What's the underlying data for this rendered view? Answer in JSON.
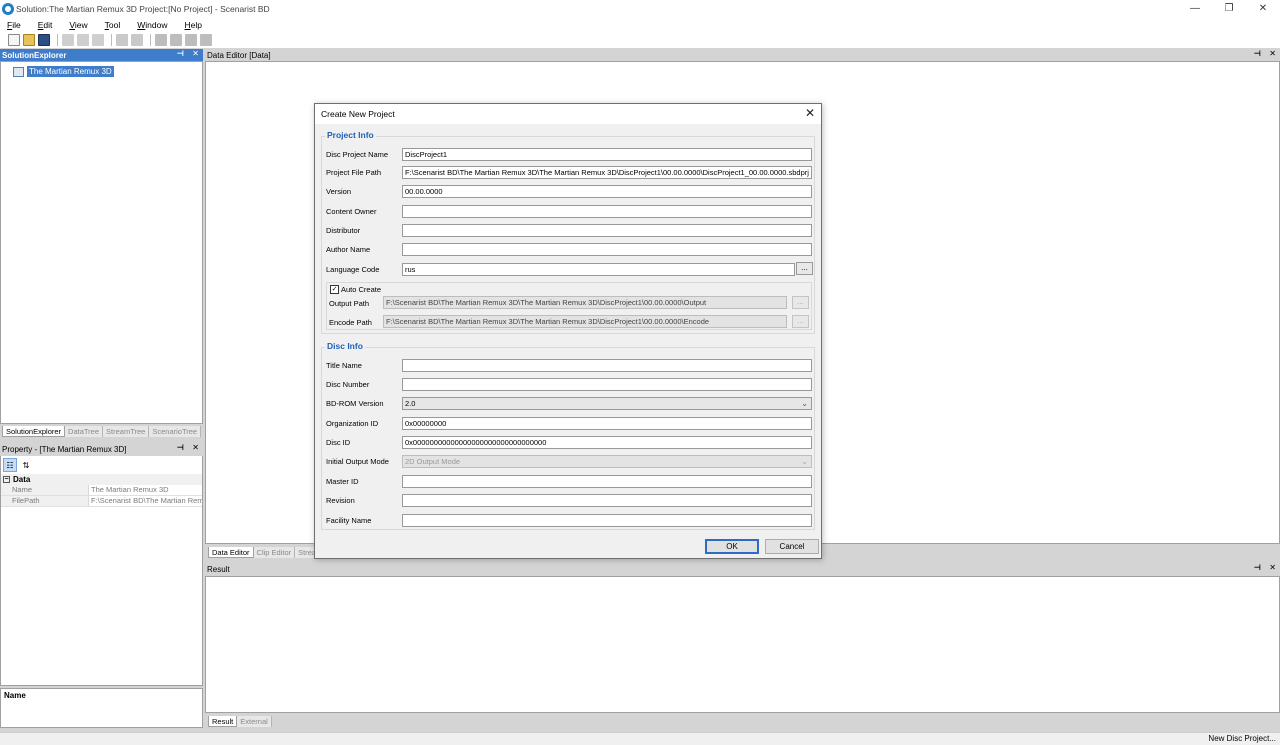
{
  "window": {
    "title": "Solution:The Martian Remux 3D  Project:[No Project] - Scenarist BD",
    "controls": [
      "—",
      "❐",
      "✕"
    ]
  },
  "menu": [
    "File",
    "Edit",
    "View",
    "Tool",
    "Window",
    "Help"
  ],
  "solution_explorer": {
    "title": "SolutionExplorer",
    "root_item": "The Martian Remux 3D",
    "tabs": [
      "SolutionExplorer",
      "DataTree",
      "StreamTree",
      "ScenarioTree"
    ]
  },
  "property_panel": {
    "title": "Property - [The Martian Remux 3D]",
    "category": "Data",
    "rows": [
      {
        "key": "Name",
        "value": "The Martian Remux 3D"
      },
      {
        "key": "FilePath",
        "value": "F:\\Scenarist BD\\The Martian Remu"
      }
    ],
    "description_title": "Name"
  },
  "data_editor": {
    "title": "Data Editor [Data]",
    "tabs": [
      "Data Editor",
      "Clip Editor",
      "Strea"
    ]
  },
  "result_panel": {
    "title": "Result",
    "tabs": [
      "Result",
      "External"
    ]
  },
  "status": {
    "text": "New Disc Project..."
  },
  "dialog": {
    "title": "Create New Project",
    "project_info": {
      "heading": "Project Info",
      "fields": [
        {
          "label": "Disc Project Name",
          "value": "DiscProject1"
        },
        {
          "label": "Project File Path",
          "value": "F:\\Scenarist BD\\The Martian Remux 3D\\The Martian Remux 3D\\DiscProject1\\00.00.0000\\DiscProject1_00.00.0000.sbdprj"
        },
        {
          "label": "Version",
          "value": "00.00.0000"
        },
        {
          "label": "Content Owner",
          "value": ""
        },
        {
          "label": "Distributor",
          "value": ""
        },
        {
          "label": "Author Name",
          "value": ""
        },
        {
          "label": "Language Code",
          "value": "rus"
        }
      ],
      "browse_label": "...",
      "auto_create": {
        "label": "Auto Create",
        "checked": true,
        "output_label": "Output Path",
        "output_value": "F:\\Scenarist BD\\The Martian Remux 3D\\The Martian Remux 3D\\DiscProject1\\00.00.0000\\Output",
        "encode_label": "Encode Path",
        "encode_value": "F:\\Scenarist BD\\The Martian Remux 3D\\The Martian Remux 3D\\DiscProject1\\00.00.0000\\Encode"
      }
    },
    "disc_info": {
      "heading": "Disc Info",
      "fields": [
        {
          "label": "Title Name",
          "value": ""
        },
        {
          "label": "Disc Number",
          "value": ""
        },
        {
          "label": "BD-ROM Version",
          "value": "2.0"
        },
        {
          "label": "Organization ID",
          "value": "0x00000000"
        },
        {
          "label": "Disc ID",
          "value": "0x00000000000000000000000000000000"
        },
        {
          "label": "Initial Output Mode",
          "value": "2D Output Mode"
        },
        {
          "label": "Master ID",
          "value": ""
        },
        {
          "label": "Revision",
          "value": ""
        },
        {
          "label": "Facility Name",
          "value": ""
        }
      ]
    },
    "ok_label": "OK",
    "cancel_label": "Cancel"
  },
  "colors": {
    "accent": "#3f7dcb",
    "group_title": "#1f5fb5"
  }
}
